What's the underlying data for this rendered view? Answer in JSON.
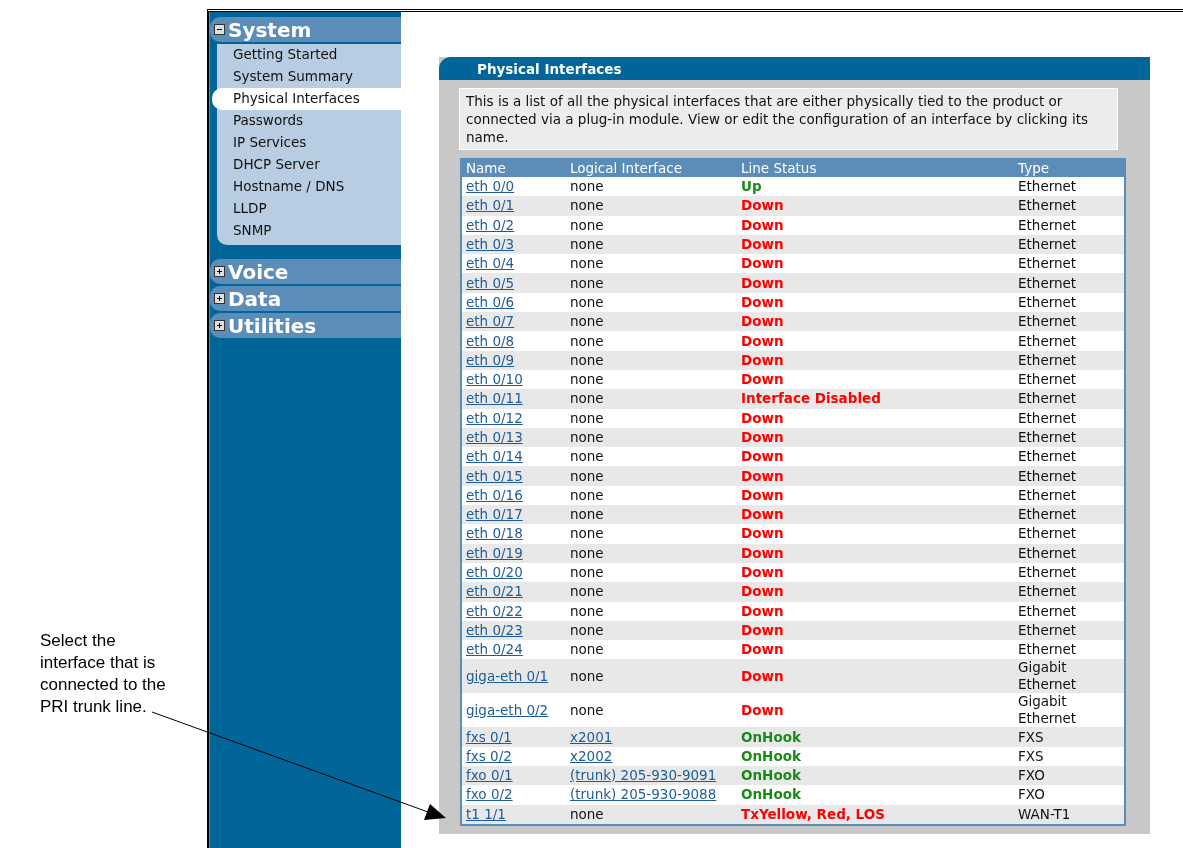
{
  "annotation": "Select the interface that is connected to the PRI trunk line.",
  "sidebar": {
    "sections": [
      {
        "title": "System",
        "expanded": true,
        "items": [
          {
            "label": "Getting Started",
            "selected": false
          },
          {
            "label": "System Summary",
            "selected": false
          },
          {
            "label": "Physical Interfaces",
            "selected": true
          },
          {
            "label": "Passwords",
            "selected": false
          },
          {
            "label": "IP Services",
            "selected": false
          },
          {
            "label": "DHCP Server",
            "selected": false
          },
          {
            "label": "Hostname / DNS",
            "selected": false
          },
          {
            "label": "LLDP",
            "selected": false
          },
          {
            "label": "SNMP",
            "selected": false
          }
        ]
      },
      {
        "title": "Voice",
        "expanded": false
      },
      {
        "title": "Data",
        "expanded": false
      },
      {
        "title": "Utilities",
        "expanded": false
      }
    ]
  },
  "panel": {
    "title": "Physical Interfaces",
    "description": "This is a list of all the physical interfaces that are either physically tied to the product or connected via a plug-in module. View or edit the configuration of an interface by clicking its name.",
    "table": {
      "columns": [
        "Name",
        "Logical Interface",
        "Line Status",
        "Type"
      ],
      "rows": [
        {
          "name": "eth 0/0",
          "logical": "none",
          "logical_link": false,
          "status": "Up",
          "color": "#1a8a1a",
          "type": "Ethernet"
        },
        {
          "name": "eth 0/1",
          "logical": "none",
          "logical_link": false,
          "status": "Down",
          "color": "#ff0000",
          "type": "Ethernet"
        },
        {
          "name": "eth 0/2",
          "logical": "none",
          "logical_link": false,
          "status": "Down",
          "color": "#ff0000",
          "type": "Ethernet"
        },
        {
          "name": "eth 0/3",
          "logical": "none",
          "logical_link": false,
          "status": "Down",
          "color": "#ff0000",
          "type": "Ethernet"
        },
        {
          "name": "eth 0/4",
          "logical": "none",
          "logical_link": false,
          "status": "Down",
          "color": "#ff0000",
          "type": "Ethernet"
        },
        {
          "name": "eth 0/5",
          "logical": "none",
          "logical_link": false,
          "status": "Down",
          "color": "#ff0000",
          "type": "Ethernet"
        },
        {
          "name": "eth 0/6",
          "logical": "none",
          "logical_link": false,
          "status": "Down",
          "color": "#ff0000",
          "type": "Ethernet"
        },
        {
          "name": "eth 0/7",
          "logical": "none",
          "logical_link": false,
          "status": "Down",
          "color": "#ff0000",
          "type": "Ethernet"
        },
        {
          "name": "eth 0/8",
          "logical": "none",
          "logical_link": false,
          "status": "Down",
          "color": "#ff0000",
          "type": "Ethernet"
        },
        {
          "name": "eth 0/9",
          "logical": "none",
          "logical_link": false,
          "status": "Down",
          "color": "#ff0000",
          "type": "Ethernet"
        },
        {
          "name": "eth 0/10",
          "logical": "none",
          "logical_link": false,
          "status": "Down",
          "color": "#ff0000",
          "type": "Ethernet"
        },
        {
          "name": "eth 0/11",
          "logical": "none",
          "logical_link": false,
          "status": "Interface Disabled",
          "color": "#ff0000",
          "type": "Ethernet"
        },
        {
          "name": "eth 0/12",
          "logical": "none",
          "logical_link": false,
          "status": "Down",
          "color": "#ff0000",
          "type": "Ethernet"
        },
        {
          "name": "eth 0/13",
          "logical": "none",
          "logical_link": false,
          "status": "Down",
          "color": "#ff0000",
          "type": "Ethernet"
        },
        {
          "name": "eth 0/14",
          "logical": "none",
          "logical_link": false,
          "status": "Down",
          "color": "#ff0000",
          "type": "Ethernet"
        },
        {
          "name": "eth 0/15",
          "logical": "none",
          "logical_link": false,
          "status": "Down",
          "color": "#ff0000",
          "type": "Ethernet"
        },
        {
          "name": "eth 0/16",
          "logical": "none",
          "logical_link": false,
          "status": "Down",
          "color": "#ff0000",
          "type": "Ethernet"
        },
        {
          "name": "eth 0/17",
          "logical": "none",
          "logical_link": false,
          "status": "Down",
          "color": "#ff0000",
          "type": "Ethernet"
        },
        {
          "name": "eth 0/18",
          "logical": "none",
          "logical_link": false,
          "status": "Down",
          "color": "#ff0000",
          "type": "Ethernet"
        },
        {
          "name": "eth 0/19",
          "logical": "none",
          "logical_link": false,
          "status": "Down",
          "color": "#ff0000",
          "type": "Ethernet"
        },
        {
          "name": "eth 0/20",
          "logical": "none",
          "logical_link": false,
          "status": "Down",
          "color": "#ff0000",
          "type": "Ethernet"
        },
        {
          "name": "eth 0/21",
          "logical": "none",
          "logical_link": false,
          "status": "Down",
          "color": "#ff0000",
          "type": "Ethernet"
        },
        {
          "name": "eth 0/22",
          "logical": "none",
          "logical_link": false,
          "status": "Down",
          "color": "#ff0000",
          "type": "Ethernet"
        },
        {
          "name": "eth 0/23",
          "logical": "none",
          "logical_link": false,
          "status": "Down",
          "color": "#ff0000",
          "type": "Ethernet"
        },
        {
          "name": "eth 0/24",
          "logical": "none",
          "logical_link": false,
          "status": "Down",
          "color": "#ff0000",
          "type": "Ethernet"
        },
        {
          "name": "giga-eth 0/1",
          "logical": "none",
          "logical_link": false,
          "status": "Down",
          "color": "#ff0000",
          "type": "Gigabit Ethernet"
        },
        {
          "name": "giga-eth 0/2",
          "logical": "none",
          "logical_link": false,
          "status": "Down",
          "color": "#ff0000",
          "type": "Gigabit Ethernet"
        },
        {
          "name": "fxs 0/1",
          "logical": "x2001",
          "logical_link": true,
          "status": "OnHook",
          "color": "#1a8a1a",
          "type": "FXS"
        },
        {
          "name": "fxs 0/2",
          "logical": "x2002",
          "logical_link": true,
          "status": "OnHook",
          "color": "#1a8a1a",
          "type": "FXS"
        },
        {
          "name": "fxo 0/1",
          "logical": "(trunk) 205-930-9091",
          "logical_link": true,
          "status": "OnHook",
          "color": "#1a8a1a",
          "type": "FXO"
        },
        {
          "name": "fxo 0/2",
          "logical": "(trunk) 205-930-9088",
          "logical_link": true,
          "status": "OnHook",
          "color": "#1a8a1a",
          "type": "FXO"
        },
        {
          "name": "t1 1/1",
          "logical": "none",
          "logical_link": false,
          "status": "TxYellow, Red, LOS",
          "color": "#ff0000",
          "type": "WAN-T1"
        }
      ]
    }
  }
}
